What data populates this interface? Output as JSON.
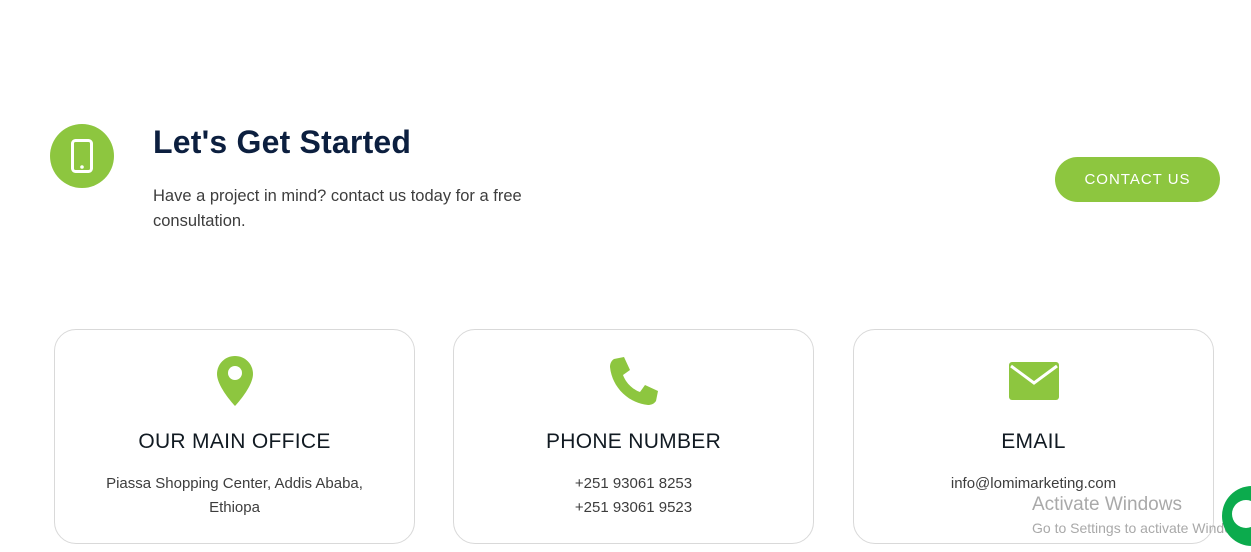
{
  "cta": {
    "icon": "mobile-phone-icon",
    "title": "Let's Get Started",
    "text": "Have a project in mind? contact us today for a free consultation.",
    "button_label": "CONTACT US"
  },
  "cards": [
    {
      "icon": "location-pin-icon",
      "title": "OUR MAIN OFFICE",
      "lines": [
        "Piassa Shopping Center, Addis Ababa, Ethiopa"
      ]
    },
    {
      "icon": "phone-icon",
      "title": "PHONE NUMBER",
      "lines": [
        "+251 93061 8253",
        "+251 93061 9523"
      ]
    },
    {
      "icon": "envelope-icon",
      "title": "EMAIL",
      "lines": [
        "info@lomimarketing.com"
      ]
    }
  ],
  "watermark": {
    "line1": "Activate Windows",
    "line2": "Go to Settings to activate Windows."
  },
  "chat_widget": {
    "icon": "chat-icon"
  },
  "colors": {
    "accent": "#8dc63f",
    "heading": "#0c1f3f",
    "chat": "#0cab4d"
  }
}
